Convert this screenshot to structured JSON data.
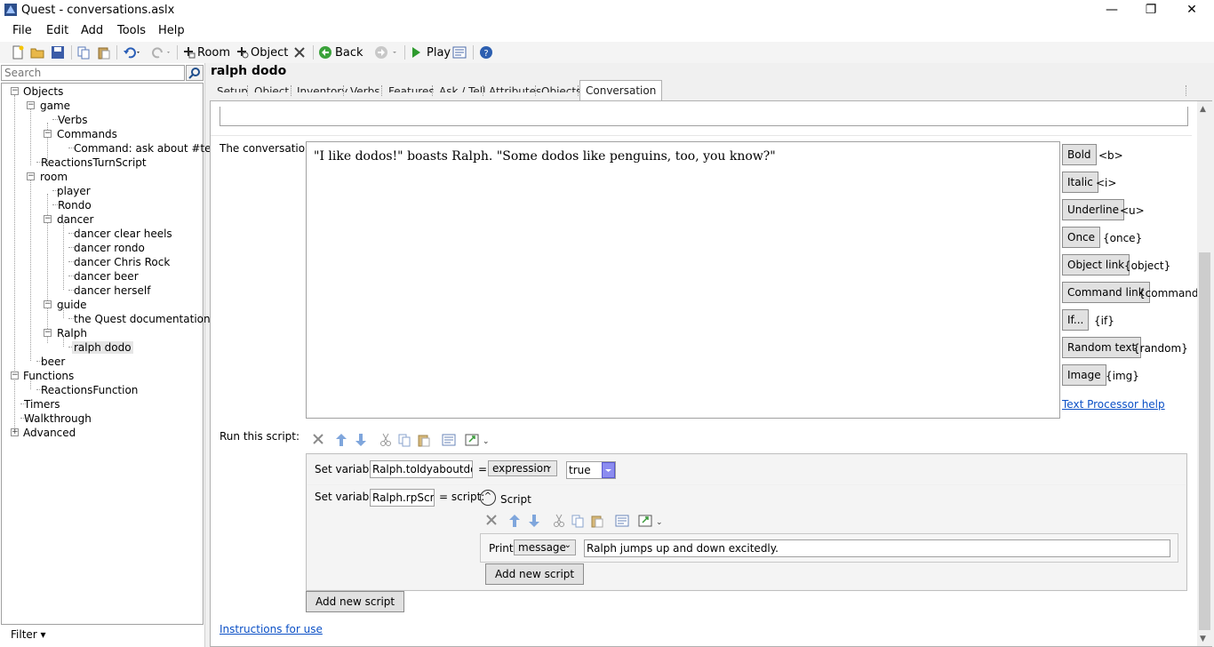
{
  "window": {
    "title": "Quest - conversations.aslx",
    "minimize": "—",
    "restore": "❐",
    "close": "✕"
  },
  "menu": [
    "File",
    "Edit",
    "Add",
    "Tools",
    "Help"
  ],
  "toolbar": {
    "room": "Room",
    "object": "Object",
    "back": "Back",
    "play": "Play"
  },
  "search": {
    "placeholder": "Search"
  },
  "tree": {
    "objects": "Objects",
    "game": "game",
    "verbs": "Verbs",
    "commands": "Commands",
    "command_ask": "Command: ask about #text#",
    "reactions_turn": "ReactionsTurnScript",
    "room": "room",
    "player": "player",
    "rondo": "Rondo",
    "dancer": "dancer",
    "dancer_clear_heels": "dancer clear heels",
    "dancer_rondo": "dancer rondo",
    "dancer_chris_rock": "dancer Chris Rock",
    "dancer_beer": "dancer beer",
    "dancer_herself": "dancer herself",
    "guide": "guide",
    "quest_doc": "the Quest documentation",
    "ralph": "Ralph",
    "ralph_dodo": "ralph dodo",
    "beer": "beer",
    "functions": "Functions",
    "reactions_function": "ReactionsFunction",
    "timers": "Timers",
    "walkthrough": "Walkthrough",
    "advanced": "Advanced"
  },
  "filter": "Filter ▾",
  "object_name": "ralph dodo",
  "tabs": [
    "Setup",
    "Object",
    "Inventory",
    "Verbs",
    "Features",
    "Ask / Tell",
    "Attributes",
    "Objects",
    "Conversation"
  ],
  "conversation": {
    "label": "The conversation:",
    "text": "\"I like dodos!\" boasts Ralph.  \"Some dodos like penguins, too, you know?\"",
    "buttons": [
      {
        "label": "Bold",
        "tag": "<b>"
      },
      {
        "label": "Italic",
        "tag": "<i>"
      },
      {
        "label": "Underline",
        "tag": "<u>"
      },
      {
        "label": "Once",
        "tag": "{once}"
      },
      {
        "label": "Object link",
        "tag": "{object}"
      },
      {
        "label": "Command link",
        "tag": "{command}"
      },
      {
        "label": "If...",
        "tag": "{if}"
      },
      {
        "label": "Random text",
        "tag": "{random}"
      },
      {
        "label": "Image",
        "tag": "{img}"
      }
    ],
    "help_link": "Text Processor help"
  },
  "script": {
    "label": "Run this script:",
    "line1": {
      "prefix": "Set variable",
      "var": "Ralph.toldyaboutdodos",
      "eq": "=",
      "type": "expression",
      "value": "true"
    },
    "line2": {
      "prefix": "Set variable",
      "var": "Ralph.rpScript",
      "eq": "= script:",
      "script_label": "Script"
    },
    "print": {
      "label": "Print",
      "type": "message",
      "value": "Ralph jumps up and down excitedly."
    },
    "add_inner": "Add new script",
    "add_outer": "Add new script"
  },
  "instructions": "Instructions for use"
}
